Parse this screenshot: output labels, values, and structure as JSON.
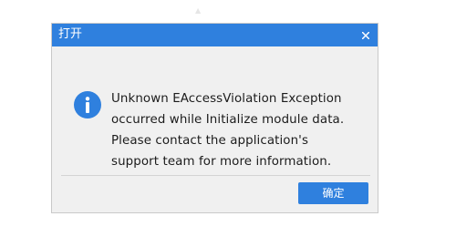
{
  "dialog": {
    "title": "打开",
    "message_lines": [
      "Unknown EAccessViolation Exception",
      "occurred while Initialize module data.",
      "Please contact the application's",
      "support team for more information."
    ],
    "ok_label": "确定",
    "icons": {
      "close": "close-icon",
      "info": "info-icon"
    }
  },
  "colors": {
    "accent": "#2f80de",
    "dialog_background": "#f0f0f0",
    "text": "#1c1c1c"
  }
}
